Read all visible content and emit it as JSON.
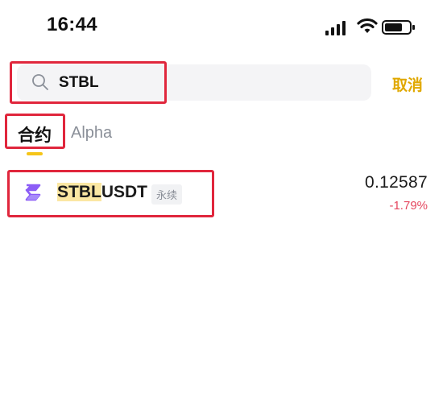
{
  "status_bar": {
    "time": "16:44",
    "icons": [
      "cellular-signal-icon",
      "wifi-icon",
      "battery-icon"
    ]
  },
  "search": {
    "value": "STBL",
    "cancel_label": "取消",
    "icon": "search-icon"
  },
  "tabs": [
    {
      "label": "合约",
      "active": true
    },
    {
      "label": "Alpha",
      "active": false
    }
  ],
  "results": [
    {
      "symbol_highlight": "STBL",
      "symbol_rest": "USDT",
      "tag": "永续",
      "price": "0.12587",
      "change": "-1.79%",
      "icon": "stbl-coin-icon"
    }
  ],
  "colors": {
    "accent": "#e0a800",
    "tab_indicator": "#f5c518",
    "highlight": "#fbe7a3",
    "negative": "#e5475f",
    "annotation": "#e0263c",
    "coin": "#8b5cf6"
  }
}
